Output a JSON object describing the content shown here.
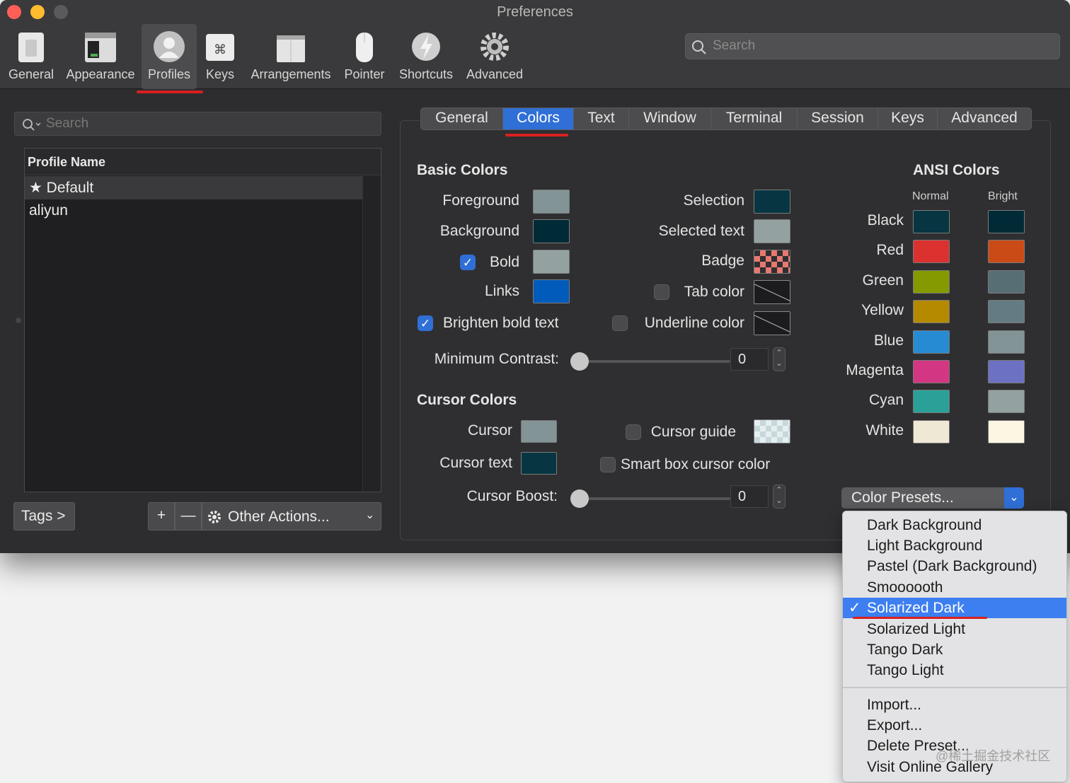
{
  "window": {
    "title": "Preferences"
  },
  "toolbar": {
    "items": [
      "General",
      "Appearance",
      "Profiles",
      "Keys",
      "Arrangements",
      "Pointer",
      "Shortcuts",
      "Advanced"
    ],
    "active": "Profiles",
    "search_placeholder": "Search"
  },
  "profiles": {
    "search_placeholder": "Search",
    "column_header": "Profile Name",
    "items": [
      "Default",
      "aliyun"
    ],
    "selected": "Default",
    "tags_label": "Tags >",
    "add_label": "+",
    "remove_label": "—",
    "other_actions_label": "Other Actions..."
  },
  "tabs": {
    "items": [
      "General",
      "Colors",
      "Text",
      "Window",
      "Terminal",
      "Session",
      "Keys",
      "Advanced"
    ],
    "active": "Colors"
  },
  "basic": {
    "title": "Basic Colors",
    "foreground": "Foreground",
    "background": "Background",
    "bold": "Bold",
    "links": "Links",
    "selection": "Selection",
    "selected_text": "Selected text",
    "badge": "Badge",
    "tab_color": "Tab color",
    "brighten": "Brighten bold text",
    "underline": "Underline color",
    "min_contrast": "Minimum Contrast:",
    "min_contrast_value": "0"
  },
  "cursor": {
    "title": "Cursor Colors",
    "cursor": "Cursor",
    "cursor_text": "Cursor text",
    "cursor_guide": "Cursor guide",
    "smart_box": "Smart box cursor color",
    "boost": "Cursor Boost:",
    "boost_value": "0"
  },
  "ansi": {
    "title": "ANSI Colors",
    "normal": "Normal",
    "bright": "Bright",
    "rows": [
      "Black",
      "Red",
      "Green",
      "Yellow",
      "Blue",
      "Magenta",
      "Cyan",
      "White"
    ]
  },
  "presets": {
    "label": "Color Presets...",
    "menu": [
      "Dark Background",
      "Light Background",
      "Pastel (Dark Background)",
      "Smoooooth",
      "Solarized Dark",
      "Solarized Light",
      "Tango Dark",
      "Tango Light"
    ],
    "selected": "Solarized Dark",
    "check": "✓",
    "actions": [
      "Import...",
      "Export...",
      "Delete Preset...",
      "Visit Online Gallery"
    ]
  },
  "colors": {
    "foreground": "#839496",
    "background": "#002b36",
    "bold": "#93a1a1",
    "links": "#005bbb",
    "selection": "#073642",
    "selected_text": "#93a1a1",
    "badge": "#f08080",
    "cursor": "#839496",
    "cursor_text": "#073642",
    "accent": "#2f6fd6",
    "ansi_normal": [
      "#073642",
      "#dc322f",
      "#859900",
      "#b58900",
      "#268bd2",
      "#d33682",
      "#2aa198",
      "#eee8d5"
    ],
    "ansi_bright": [
      "#002b36",
      "#cb4b16",
      "#586e75",
      "#657b83",
      "#839496",
      "#6c71c4",
      "#93a1a1",
      "#fdf6e3"
    ]
  },
  "icons": {
    "search": "search-icon",
    "star": "star-icon",
    "gear": "gear-icon"
  },
  "watermark": "@稀土掘金技术社区"
}
